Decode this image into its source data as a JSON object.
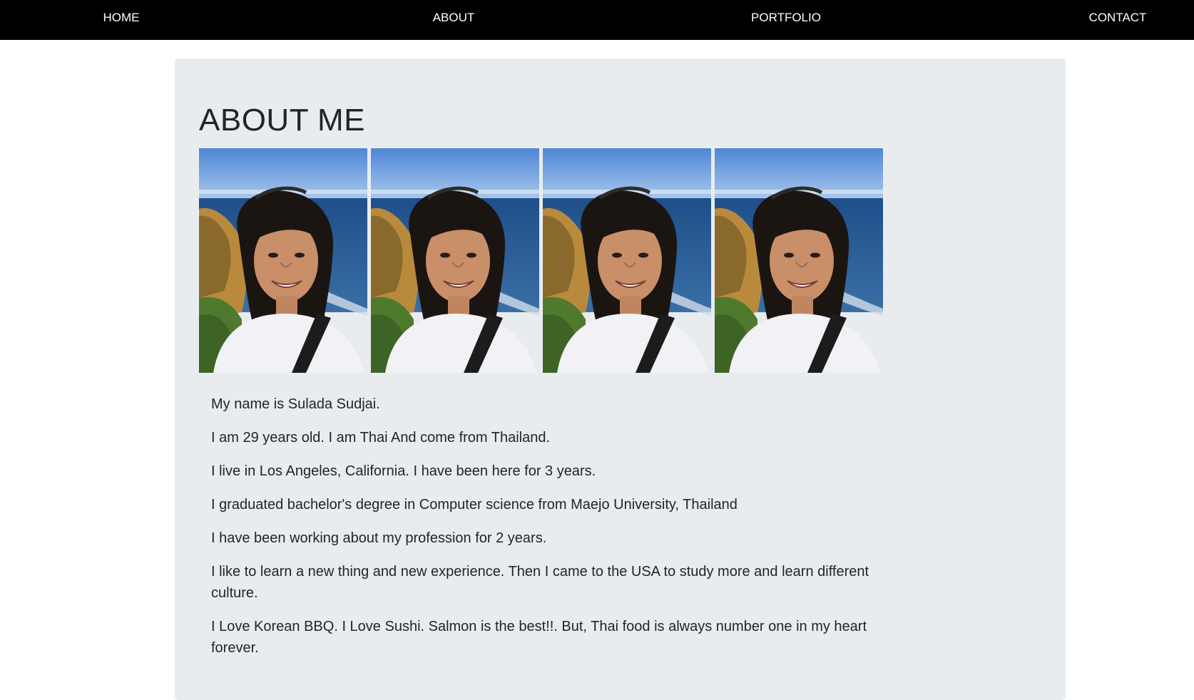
{
  "nav": {
    "items": [
      {
        "label": "HOME"
      },
      {
        "label": "ABOUT"
      },
      {
        "label": "PORTFOLIO"
      },
      {
        "label": "CONTACT"
      }
    ]
  },
  "about": {
    "title": "ABOUT ME",
    "paragraphs": [
      "My name is Sulada Sudjai.",
      "I am 29 years old. I am Thai And come from Thailand.",
      "I live in Los Angeles, California. I have been here for 3 years.",
      "I graduated bachelor's degree in Computer science from Maejo University, Thailand",
      "I have been working about my profession for 2 years.",
      "I like to learn a new thing and new experience. Then I came to the USA to study more and learn different culture.",
      "I Love Korean BBQ. I Love Sushi. Salmon is the best!!. But, Thai food is always number one in my heart forever."
    ]
  },
  "colors": {
    "navbar": "#000000",
    "jumbotron": "#e9ecef",
    "text": "#212529"
  }
}
